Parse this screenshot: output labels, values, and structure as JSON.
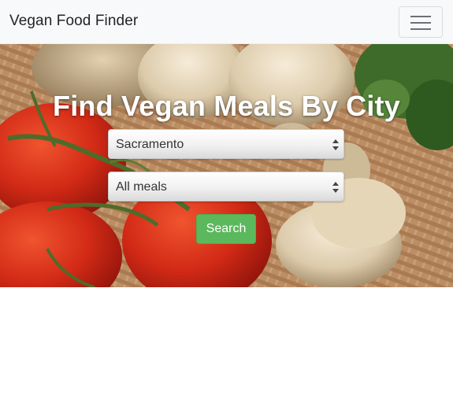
{
  "navbar": {
    "brand": "Vegan Food Finder",
    "menu_icon": "hamburger-menu-icon"
  },
  "hero": {
    "headline": "Find Vegan Meals By City",
    "background": "vegetables-photo",
    "city_select": {
      "value": "Sacramento"
    },
    "meal_select": {
      "value": "All meals"
    },
    "search_label": "Search"
  },
  "colors": {
    "navbar_bg": "#f8f9fa",
    "search_button": "#5cb85c",
    "headline": "#ffffff"
  }
}
